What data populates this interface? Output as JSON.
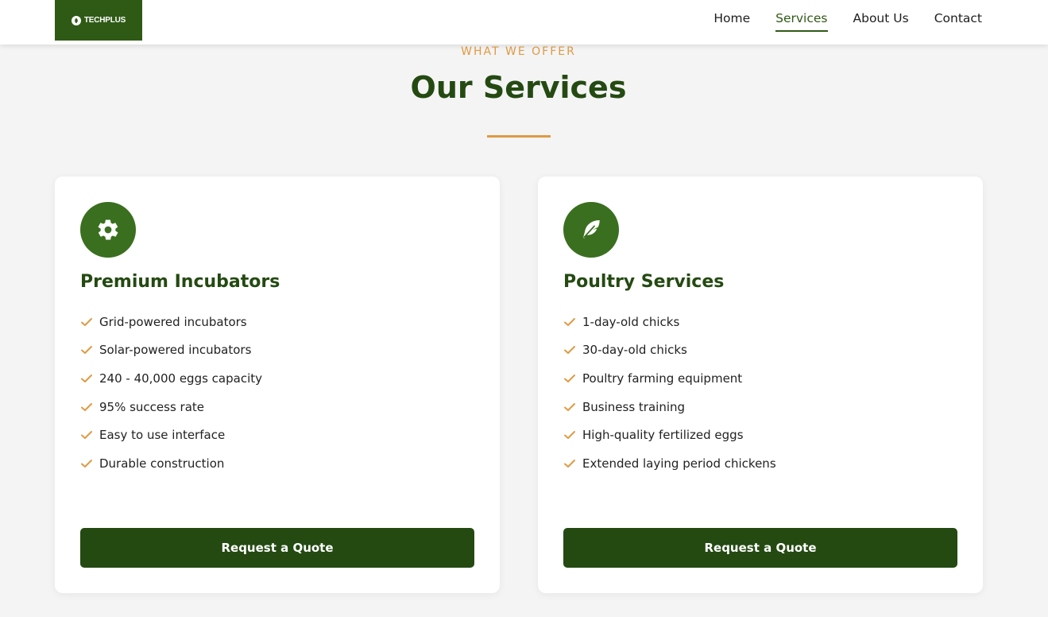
{
  "brand": {
    "name": "TECHPLUS",
    "primary_color": "#244a12",
    "accent_color": "#e09a43"
  },
  "nav": {
    "items": [
      {
        "label": "Home",
        "active": false
      },
      {
        "label": "Services",
        "active": true
      },
      {
        "label": "About Us",
        "active": false
      },
      {
        "label": "Contact",
        "active": false
      }
    ]
  },
  "section": {
    "eyebrow": "WHAT WE OFFER",
    "title": "Our Services"
  },
  "cards": [
    {
      "icon": "gear-icon",
      "title": "Premium Incubators",
      "features": [
        "Grid-powered incubators",
        "Solar-powered incubators",
        "240 - 40,000 eggs capacity",
        "95% success rate",
        "Easy to use interface",
        "Durable construction"
      ],
      "button_label": "Request a Quote"
    },
    {
      "icon": "feather-icon",
      "title": "Poultry Services",
      "features": [
        "1-day-old chicks",
        "30-day-old chicks",
        "Poultry farming equipment",
        "Business training",
        "High-quality fertilized eggs",
        "Extended laying period chickens"
      ],
      "button_label": "Request a Quote"
    }
  ]
}
